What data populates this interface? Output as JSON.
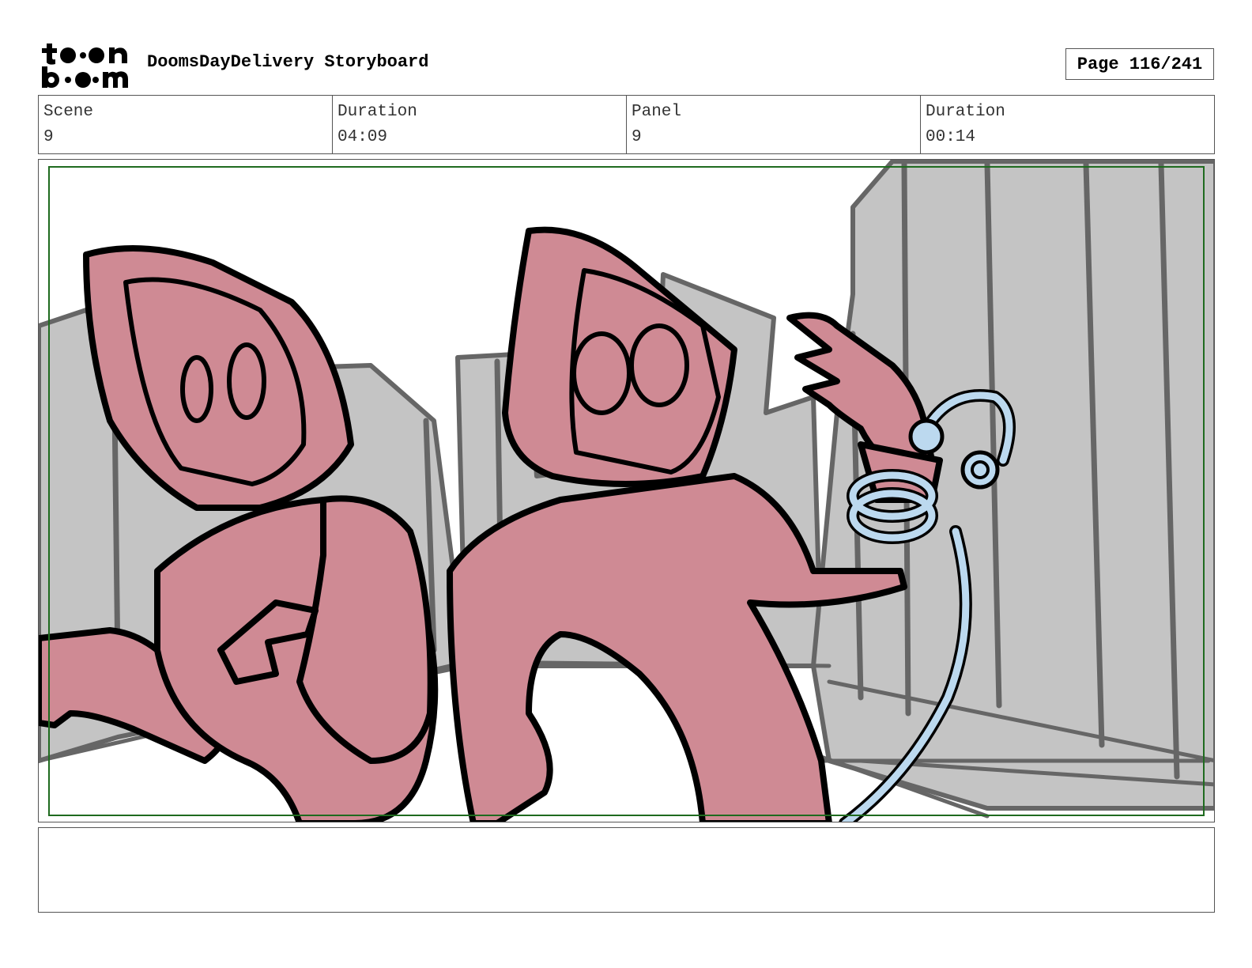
{
  "header": {
    "logo_text": "toon boom",
    "title": "DoomsDayDelivery Storyboard",
    "page_label": "Page 116/241"
  },
  "info": {
    "scene_label": "Scene",
    "scene_value": "9",
    "scene_duration_label": "Duration",
    "scene_duration_value": "04:09",
    "panel_label": "Panel",
    "panel_value": "9",
    "panel_duration_label": "Duration",
    "panel_duration_value": "00:14"
  },
  "notes": {
    "text": ""
  },
  "colors": {
    "character_fill": "#cf8a94",
    "background_fill": "#c4c4c4",
    "cable_fill": "#bcd9ef",
    "safe_frame": "#1f6b1f",
    "ink": "#000000"
  }
}
